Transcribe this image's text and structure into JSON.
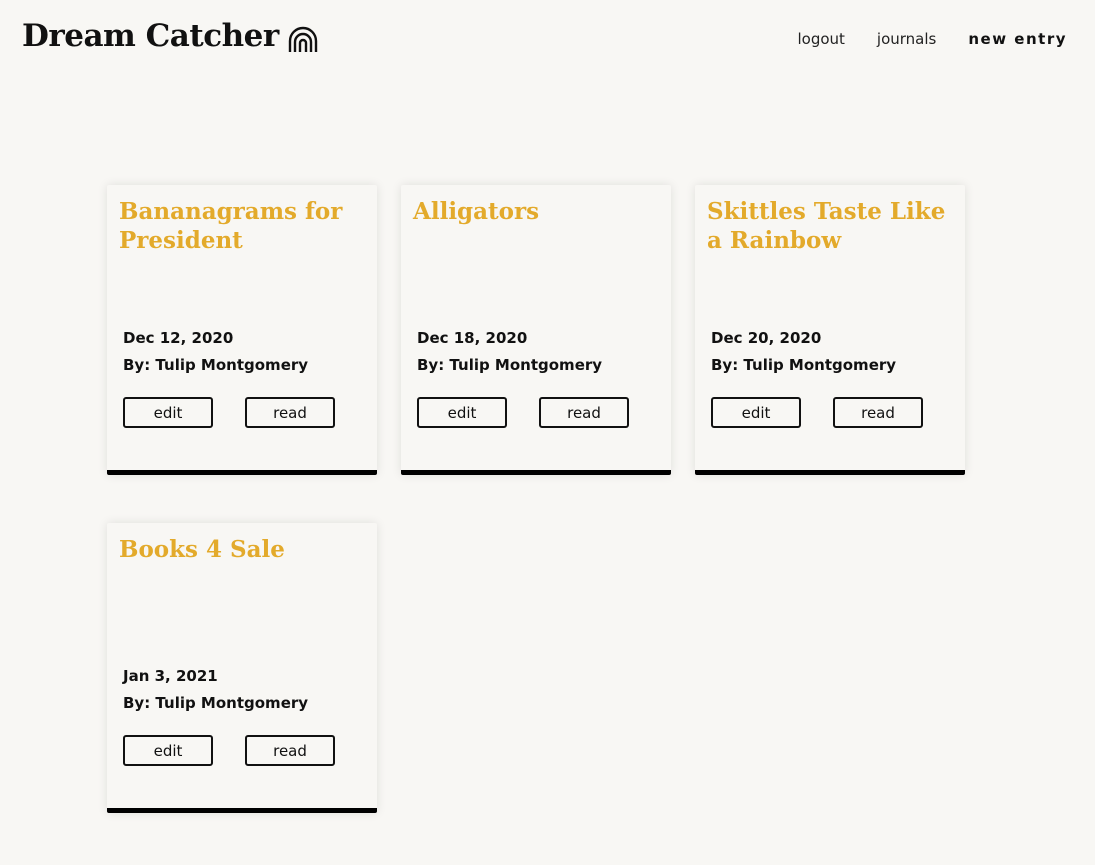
{
  "header": {
    "brand_title": "Dream Catcher",
    "brand_icon": "rainbow-icon",
    "nav": {
      "logout": "logout",
      "journals": "journals",
      "new_entry": "new entry"
    }
  },
  "colors": {
    "background": "#f8f7f4",
    "title_accent": "#e3aa2b",
    "text": "#111111"
  },
  "entries": [
    {
      "title": "Bananagrams for President",
      "date": "Dec 12, 2020",
      "author": "By: Tulip Montgomery",
      "edit_label": "edit",
      "read_label": "read"
    },
    {
      "title": "Alligators",
      "date": "Dec 18, 2020",
      "author": "By: Tulip Montgomery",
      "edit_label": "edit",
      "read_label": "read"
    },
    {
      "title": "Skittles Taste Like a Rainbow",
      "date": "Dec 20, 2020",
      "author": "By: Tulip Montgomery",
      "edit_label": "edit",
      "read_label": "read"
    },
    {
      "title": "Books 4 Sale",
      "date": "Jan 3, 2021",
      "author": "By: Tulip Montgomery",
      "edit_label": "edit",
      "read_label": "read"
    }
  ]
}
